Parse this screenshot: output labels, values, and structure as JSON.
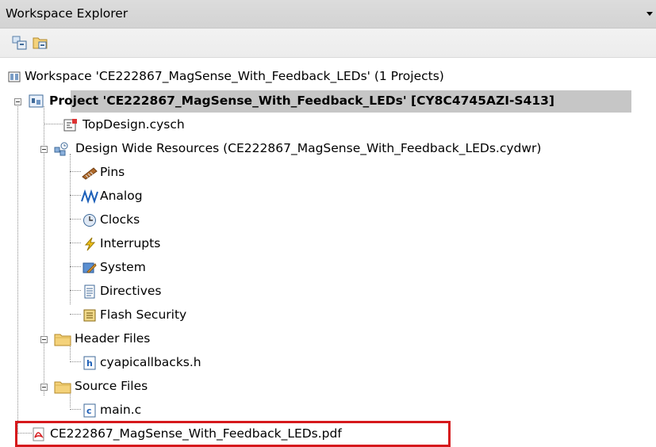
{
  "panel": {
    "title": "Workspace Explorer"
  },
  "toolbar": {
    "buttons": [
      "workspace-view-icon",
      "folder-view-icon"
    ]
  },
  "tree": {
    "workspace": "Workspace 'CE222867_MagSense_With_Feedback_LEDs' (1 Projects)",
    "project": "Project  'CE222867_MagSense_With_Feedback_LEDs' [CY8C4745AZI-S413]",
    "topdesign": "TopDesign.cysch",
    "dwr": "Design Wide Resources (CE222867_MagSense_With_Feedback_LEDs.cydwr)",
    "dwr_items": [
      "Pins",
      "Analog",
      "Clocks",
      "Interrupts",
      "System",
      "Directives",
      "Flash Security"
    ],
    "header_folder": "Header Files",
    "header_file": "cyapicallbacks.h",
    "source_folder": "Source Files",
    "source_file": "main.c",
    "pdf": "CE222867_MagSense_With_Feedback_LEDs.pdf"
  },
  "colors": {
    "highlight": "#d6191c",
    "selection": "#c6c6c6"
  }
}
